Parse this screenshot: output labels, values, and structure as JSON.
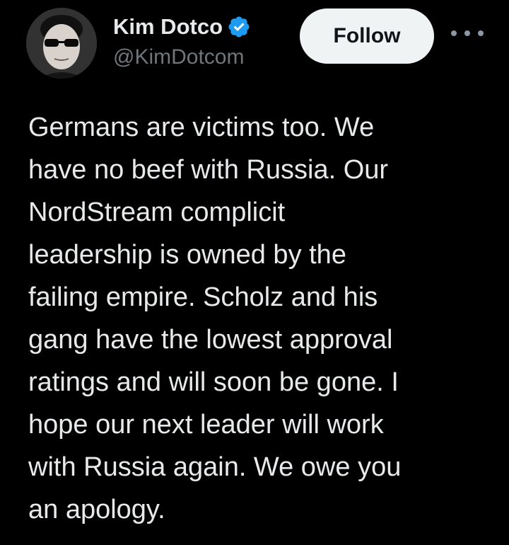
{
  "author": {
    "name": "Kim Dotco",
    "handle": "@KimDotcom",
    "verified": true,
    "avatar_icon": "avatar-kim-dotcom"
  },
  "actions": {
    "follow_label": "Follow",
    "more_icon": "more-options-icon"
  },
  "tweet": {
    "lines": [
      "Germans are victims too. We",
      "have no beef with Russia. Our",
      "NordStream complicit",
      "leadership is owned by the",
      "failing empire. Scholz and his",
      "gang have the lowest approval",
      "ratings and will soon be gone. I",
      "hope our next leader will work",
      "with Russia again. We owe you",
      "an apology."
    ]
  },
  "colors": {
    "background": "#000000",
    "text_primary": "#e7e9ea",
    "text_secondary": "#71767b",
    "verified_blue": "#1d9bf0",
    "follow_bg": "#eff3f4"
  }
}
